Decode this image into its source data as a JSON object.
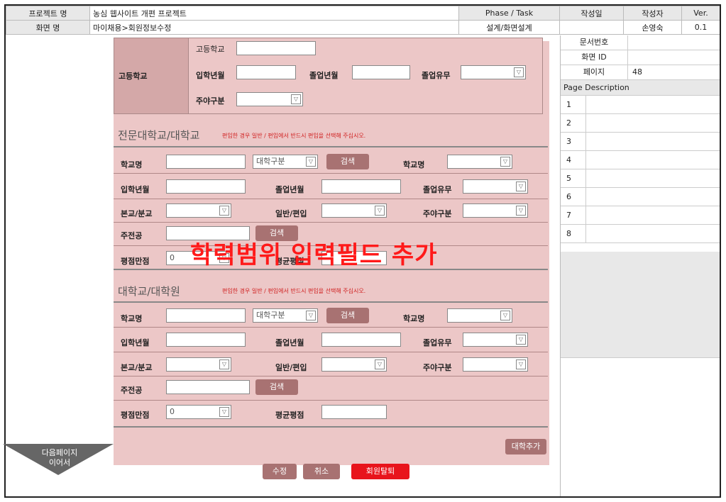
{
  "header": {
    "project_label": "프로젝트 명",
    "project_value": "농심 웹사이트 개편 프로젝트",
    "phase_label": "Phase / Task",
    "date_label": "작성일",
    "author_label": "작성자",
    "ver_label": "Ver.",
    "screen_label": "화면 명",
    "screen_value": "마이채용>회원정보수정",
    "phase_value": "설계/화면설계",
    "date_value": "",
    "author_value": "손영숙",
    "ver_value": "0.1"
  },
  "right": {
    "doc_no_label": "문서번호",
    "screen_id_label": "화면 ID",
    "page_label": "페이지",
    "page_value": "48",
    "page_desc_label": "Page Description",
    "numbers": [
      "1",
      "2",
      "3",
      "4",
      "5",
      "6",
      "7",
      "8"
    ]
  },
  "highschool": {
    "section": "고등학교",
    "school_label": "고등학교",
    "entry_label": "입학년월",
    "grad_label": "졸업년월",
    "grad_yn_label": "졸업유무",
    "daynight_label": "주야구분"
  },
  "college": {
    "title": "전문대학교/대학교",
    "note": "편입한 경우 일반 / 편입에서 반드시 편입을 선택해 주십시오.",
    "school_name_label": "학교명",
    "school_type_select": "대학구분",
    "search_btn": "검색",
    "school_name_label2": "학교명",
    "entry_label": "입학년월",
    "grad_label": "졸업년월",
    "grad_yn_label": "졸업유무",
    "branch_label": "본교/분교",
    "transfer_label": "일반/편입",
    "daynight_label": "주야구분",
    "major_label": "주전공",
    "major_search_btn": "검색",
    "gpa_max_label": "평점만점",
    "gpa_max_value": "0",
    "gpa_avg_label": "평균평점"
  },
  "university": {
    "title": "대학교/대학원",
    "note": "편입한 경우 일반 / 편입에서 반드시 편입을 선택해 주십시오.",
    "school_name_label": "학교명",
    "school_type_select": "대학구분",
    "search_btn": "검색",
    "school_name_label2": "학교명",
    "entry_label": "입학년월",
    "grad_label": "졸업년월",
    "grad_yn_label": "졸업유무",
    "branch_label": "본교/분교",
    "transfer_label": "일반/편입",
    "daynight_label": "주야구분",
    "major_label": "주전공",
    "major_search_btn": "검색",
    "gpa_max_label": "평점만점",
    "gpa_max_value": "0",
    "gpa_avg_label": "평균평점",
    "add_btn": "대학추가"
  },
  "overlay_text": "학력범위 입력필드 추가",
  "next_page": {
    "line1": "다음페이지",
    "line2": "이어서"
  },
  "actions": {
    "edit": "수정",
    "cancel": "취소",
    "withdraw": "회원탈퇴"
  },
  "colors": {
    "button": "#a87272",
    "withdraw": "#e8141c",
    "overlay": "#ff1a1a",
    "panel": "#ecc7c7"
  }
}
